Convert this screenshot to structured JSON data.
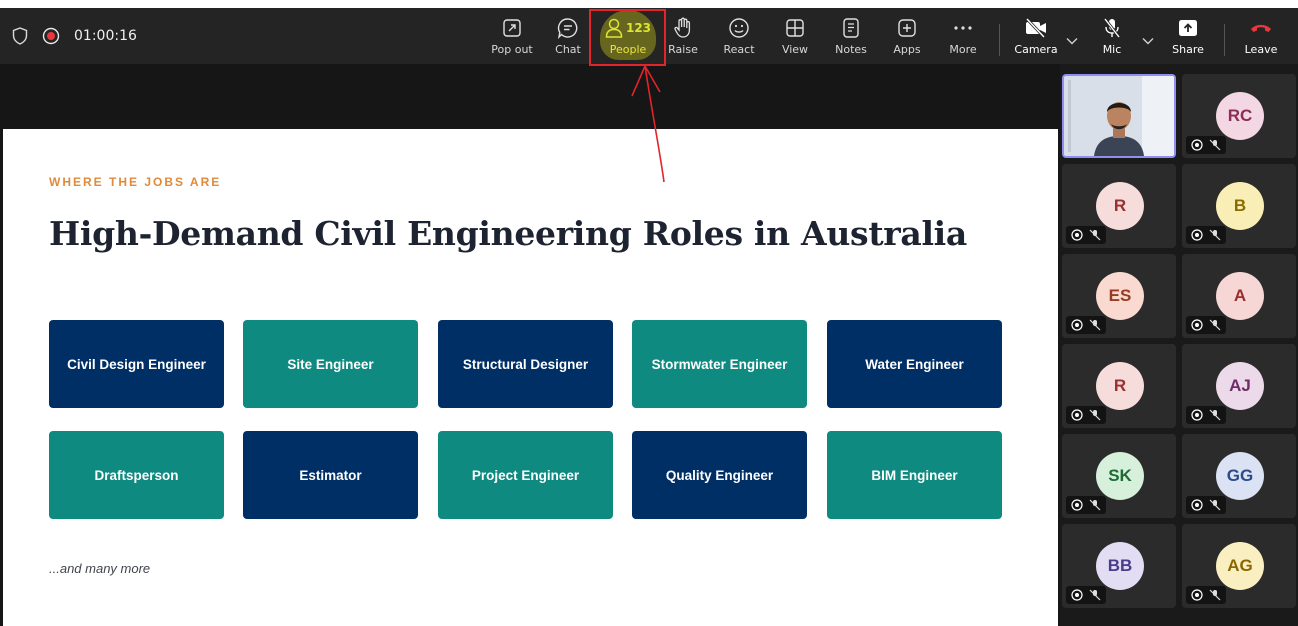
{
  "meeting": {
    "timer": "01:00:16"
  },
  "toolbar": {
    "pop_out": "Pop out",
    "chat": "Chat",
    "people": "People",
    "people_count": "123",
    "raise": "Raise",
    "react": "React",
    "view": "View",
    "notes": "Notes",
    "apps": "Apps",
    "more": "More",
    "camera": "Camera",
    "mic": "Mic",
    "share": "Share",
    "leave": "Leave"
  },
  "icons": {
    "shield": "shield-icon",
    "record": "record-icon",
    "pop_out": "pop-out-icon",
    "chat": "chat-icon",
    "people": "people-icon",
    "raise": "raise-hand-icon",
    "react": "smiley-icon",
    "view": "grid-view-icon",
    "notes": "notes-icon",
    "apps": "plus-icon",
    "more": "ellipsis-icon",
    "camera": "camera-off-icon",
    "mic": "mic-off-icon",
    "share": "share-arrow-icon",
    "leave": "phone-hangup-icon"
  },
  "colors": {
    "toolbar_bg": "#242424",
    "navy": "#002f65",
    "teal": "#0f8a80",
    "accent_orange": "#e08a3a",
    "leave_red": "#e8383d",
    "annotation_red": "#e0252b",
    "highlight_yellow": "#e6e114"
  },
  "slide": {
    "eyebrow": "WHERE THE JOBS ARE",
    "title": "High-Demand Civil Engineering Roles in Australia",
    "roles": [
      "Civil Design Engineer",
      "Site Engineer",
      "Structural Designer",
      "Stormwater Engineer",
      "Water Engineer",
      "Draftsperson",
      "Estimator",
      "Project Engineer",
      "Quality Engineer",
      "BIM Engineer"
    ],
    "footer": "...and many more"
  },
  "participants": [
    {
      "initials": "",
      "bg": "#ffffff",
      "fg": "#000000"
    },
    {
      "initials": "RC",
      "bg": "#f3d8e3",
      "fg": "#8e2d56"
    },
    {
      "initials": "R",
      "bg": "#f7dcdc",
      "fg": "#9a3030"
    },
    {
      "initials": "B",
      "bg": "#f9efb6",
      "fg": "#8c6b00"
    },
    {
      "initials": "ES",
      "bg": "#f9d9d0",
      "fg": "#9a3c22"
    },
    {
      "initials": "A",
      "bg": "#f7d6d6",
      "fg": "#9a2e2e"
    },
    {
      "initials": "R",
      "bg": "#f7dcdc",
      "fg": "#9a3030"
    },
    {
      "initials": "AJ",
      "bg": "#ecd9e9",
      "fg": "#6e2d66"
    },
    {
      "initials": "SK",
      "bg": "#d6f0dc",
      "fg": "#1e6b34"
    },
    {
      "initials": "GG",
      "bg": "#dbe2f3",
      "fg": "#2d4a8a"
    },
    {
      "initials": "BB",
      "bg": "#e3ddf3",
      "fg": "#4b3d8a"
    },
    {
      "initials": "AG",
      "bg": "#f9efc0",
      "fg": "#8c6500"
    }
  ]
}
